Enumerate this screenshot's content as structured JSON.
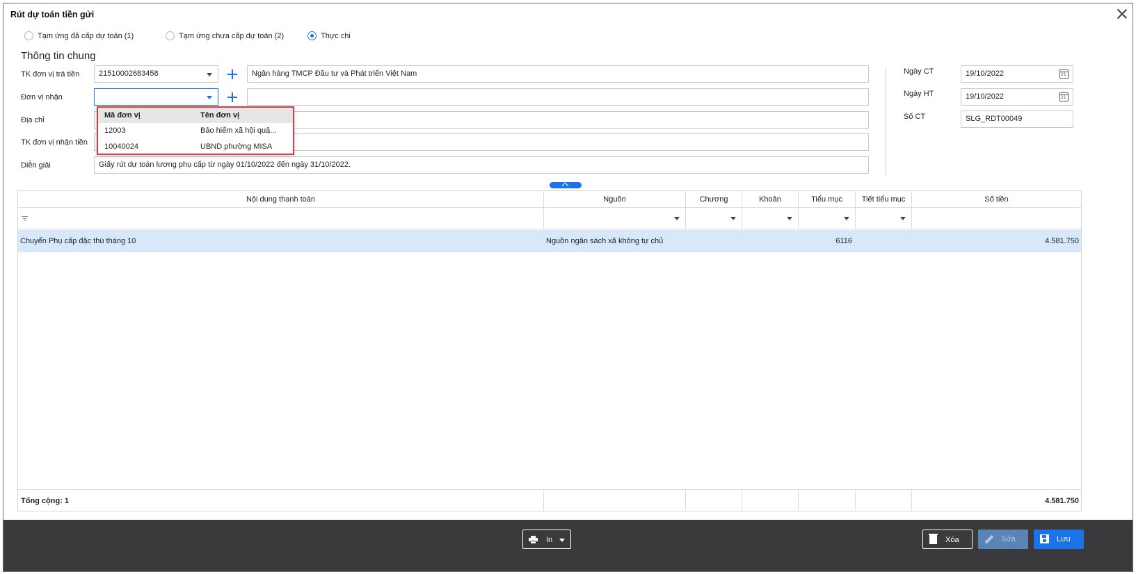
{
  "dialog": {
    "title": "Rút dự toán tiền gửi"
  },
  "radios": [
    {
      "label": "Tạm ứng đã cấp dự toán (1)",
      "checked": false
    },
    {
      "label": "Tạm ứng chưa cấp dự toán (2)",
      "checked": false
    },
    {
      "label": "Thực chi",
      "checked": true
    }
  ],
  "general": {
    "section_title": "Thông tin chung",
    "tk_tra_tien": {
      "label": "TK đơn vị trả tiền",
      "value": "21510002683458",
      "bank": "Ngân hàng TMCP Đầu tư và Phát triển Việt Nam"
    },
    "don_vi_nhan": {
      "label": "Đơn vị nhận",
      "value": "",
      "name": ""
    },
    "dia_chi": {
      "label": "Địa chỉ",
      "value": ""
    },
    "tk_nhan_tien": {
      "label": "TK đơn vị nhận tiền",
      "value": ""
    },
    "dien_giai": {
      "label": "Diễn giải",
      "value": "Giấy rút dự toán lương phụ cấp từ ngày 01/10/2022 đến ngày 31/10/2022."
    }
  },
  "voucher": {
    "ngay_ct": {
      "label": "Ngày CT",
      "value": "19/10/2022"
    },
    "ngay_ht": {
      "label": "Ngày HT",
      "value": "19/10/2022"
    },
    "so_ct": {
      "label": "Số CT",
      "value": "SLG_RDT00049"
    }
  },
  "dropdown": {
    "headers": [
      "Mã đơn vị",
      "Tên đơn vị"
    ],
    "rows": [
      {
        "code": "12003",
        "name": "Bảo hiểm xã hội quậ..."
      },
      {
        "code": "10040024",
        "name": "UBND phường MISA"
      }
    ]
  },
  "grid": {
    "columns": [
      "Nội dung thanh toán",
      "Nguồn",
      "Chương",
      "Khoản",
      "Tiểu mục",
      "Tiết tiểu mục",
      "Số tiền"
    ],
    "rows": [
      {
        "noi_dung": "Chuyển Phụ cấp đặc thù tháng 10",
        "nguon": "Nguồn ngân sách xã không tự chủ",
        "chuong": "",
        "khoan": "",
        "tieu_muc": "6116",
        "tiet_tieu_muc": "",
        "so_tien": "4.581.750"
      }
    ],
    "footer": {
      "label": "Tổng cộng: 1",
      "total": "4.581.750"
    }
  },
  "toolbar": {
    "print_label": "In",
    "delete_label": "Xóa",
    "edit_label": "Sửa",
    "save_label": "Lưu"
  },
  "colors": {
    "accent": "#1c73e8",
    "selected_row": "#d7e8fb",
    "bottom_bar": "#3a3a3c",
    "highlight_border": "#e0383e"
  }
}
